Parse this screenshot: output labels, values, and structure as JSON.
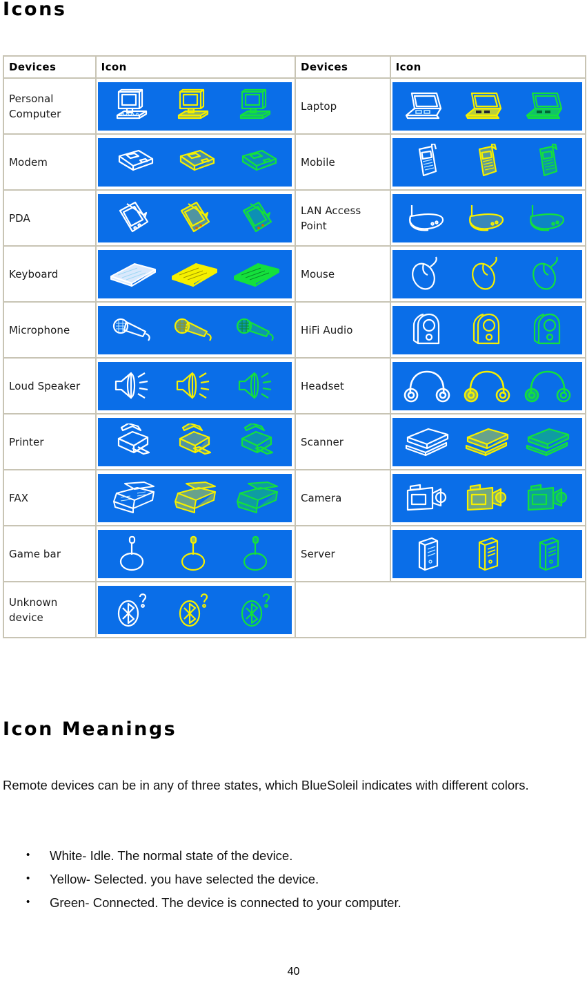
{
  "page_title": "Icons",
  "section_title": "Icon Meanings",
  "table": {
    "headers": [
      "Devices",
      "Icon",
      "Devices",
      "Icon"
    ],
    "rows": [
      {
        "left_device": "Personal Computer",
        "left_icon": "desktop-computer-icon",
        "right_device": "Laptop",
        "right_icon": "laptop-icon"
      },
      {
        "left_device": "Modem",
        "left_icon": "modem-icon",
        "right_device": "Mobile",
        "right_icon": "mobile-phone-icon"
      },
      {
        "left_device": "PDA",
        "left_icon": "pda-icon",
        "right_device": "LAN Access Point",
        "right_icon": "lan-access-point-icon"
      },
      {
        "left_device": "Keyboard",
        "left_icon": "keyboard-icon",
        "right_device": "Mouse",
        "right_icon": "mouse-icon"
      },
      {
        "left_device": "Microphone",
        "left_icon": "microphone-icon",
        "right_device": "HiFi Audio",
        "right_icon": "hifi-audio-icon"
      },
      {
        "left_device": "Loud Speaker",
        "left_icon": "loud-speaker-icon",
        "right_device": "Headset",
        "right_icon": "headset-icon"
      },
      {
        "left_device": "Printer",
        "left_icon": "printer-icon",
        "right_device": "Scanner",
        "right_icon": "scanner-icon"
      },
      {
        "left_device": "FAX",
        "left_icon": "fax-icon",
        "right_device": "Camera",
        "right_icon": "camera-icon"
      },
      {
        "left_device": "Game bar",
        "left_icon": "game-bar-icon",
        "right_device": "Server",
        "right_icon": "server-icon"
      },
      {
        "left_device": "Unknown device",
        "left_icon": "unknown-device-icon",
        "right_device": "",
        "right_icon": ""
      }
    ]
  },
  "intro_paragraph": "Remote devices can be in any of three states, which BlueSoleil indicates with different colors.",
  "bullets": [
    "White- Idle. The normal state of the device.",
    "Yellow- Selected. you have selected the device.",
    "Green- Connected. The device is connected to your computer."
  ],
  "page_number": "40",
  "colors": {
    "icon_background_blue": "#0a6ee8",
    "state_white": "#ffffff",
    "state_yellow": "#f5f000",
    "state_green": "#14e03c",
    "table_border": "#c8c4b4"
  }
}
